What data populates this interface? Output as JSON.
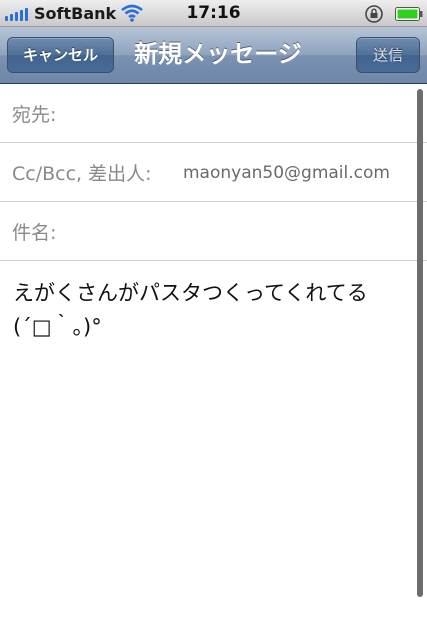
{
  "status_bar": {
    "carrier": "SoftBank",
    "time": "17:16",
    "signal_icon": "signal-bars-icon",
    "wifi_icon": "wifi-icon",
    "lock_icon": "rotation-lock-icon",
    "battery_icon": "battery-icon",
    "battery_color": "#2fd11c"
  },
  "nav": {
    "cancel_label": "キャンセル",
    "title": "新規メッセージ",
    "send_label": "送信"
  },
  "fields": {
    "to_label": "宛先:",
    "cc_label": "Cc/Bcc, 差出人:",
    "cc_value": "maonyan50@gmail.com",
    "subject_label": "件名:"
  },
  "body": {
    "text": "えがくさんがパスタつくってくれてる\n(´□｀。)°"
  },
  "colors": {
    "nav_bar": "#8fa3be",
    "signal": "#2a6fd6"
  }
}
